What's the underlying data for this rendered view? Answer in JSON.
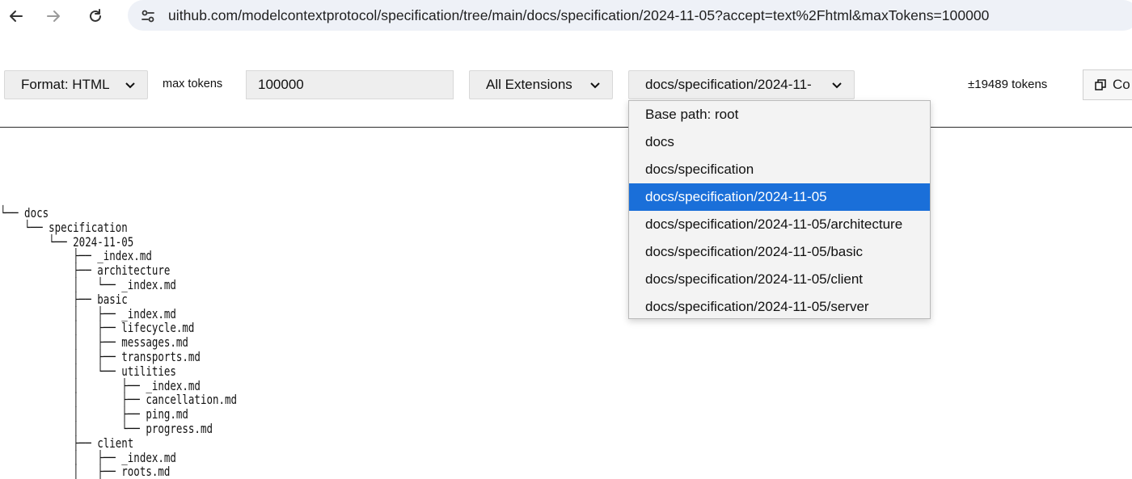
{
  "browser": {
    "url": "uithub.com/modelcontextprotocol/specification/tree/main/docs/specification/2024-11-05?accept=text%2Fhtml&maxTokens=100000"
  },
  "toolbar": {
    "format_label": "Format: HTML",
    "max_tokens_label": "max tokens",
    "max_tokens_value": "100000",
    "extensions_label": "All Extensions",
    "path_label": "docs/specification/2024-11-",
    "token_count": "±19489 tokens",
    "copy_label": "Co"
  },
  "dropdown": {
    "selected_index": 3,
    "options": [
      "Base path: root",
      "docs",
      "docs/specification",
      "docs/specification/2024-11-05",
      "docs/specification/2024-11-05/architecture",
      "docs/specification/2024-11-05/basic",
      "docs/specification/2024-11-05/client",
      "docs/specification/2024-11-05/server"
    ]
  },
  "tree": {
    "lines": [
      "└── docs",
      "    └── specification",
      "        └── 2024-11-05",
      "            ├── _index.md",
      "            ├── architecture",
      "            │   └── _index.md",
      "            ├── basic",
      "            │   ├── _index.md",
      "            │   ├── lifecycle.md",
      "            │   ├── messages.md",
      "            │   ├── transports.md",
      "            │   └── utilities",
      "            │       ├── _index.md",
      "            │       ├── cancellation.md",
      "            │       ├── ping.md",
      "            │       └── progress.md",
      "            ├── client",
      "            │   ├── _index.md",
      "            │   ├── roots.md"
    ]
  },
  "colors": {
    "url_bar_bg": "#eef1f7",
    "selected_option": "#1a6fd9"
  },
  "icons": [
    "back-arrow-icon",
    "forward-arrow-icon",
    "reload-icon",
    "site-info-icon",
    "chevron-down-icon",
    "copy-icon"
  ]
}
